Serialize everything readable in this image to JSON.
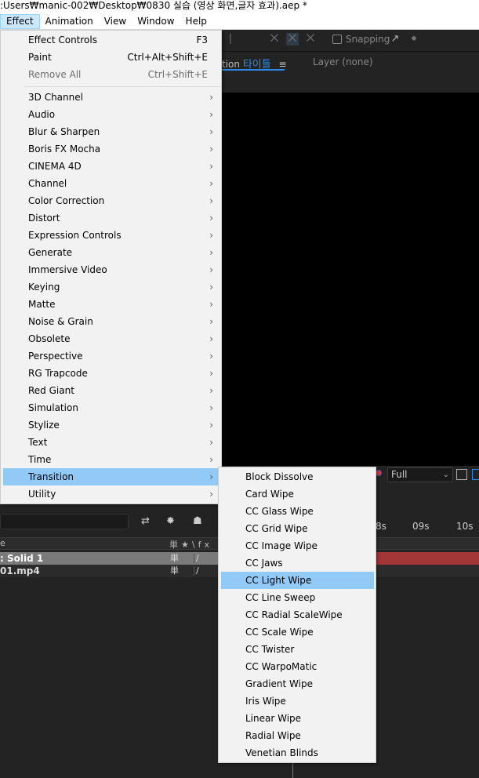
{
  "window": {
    "title": ":Users₩manic-002₩Desktop₩0830 실습 (영상 화면,글자 효과).aep *"
  },
  "menubar": {
    "items": [
      {
        "label": "Effect"
      },
      {
        "label": "Animation"
      },
      {
        "label": "View"
      },
      {
        "label": "Window"
      },
      {
        "label": "Help"
      }
    ]
  },
  "toolbar": {
    "snapping_label": "Snapping"
  },
  "composition": {
    "tab_prefix": "tion",
    "tab_name": "타이틀",
    "layer_tab": "Layer (none)",
    "quality": "Full"
  },
  "timeline": {
    "ruler_labels": [
      "8s",
      "09s",
      "10s"
    ],
    "header_left": "e",
    "header_icons": "単★\\fx",
    "layers": [
      {
        "name": "Solid 1",
        "prefix": ":"
      },
      {
        "name": "01.mp4"
      }
    ]
  },
  "effect_menu": {
    "top_items": [
      {
        "label": "Effect Controls",
        "shortcut": "F3",
        "disabled": false
      },
      {
        "label": "Paint",
        "shortcut": "Ctrl+Alt+Shift+E",
        "disabled": false
      },
      {
        "label": "Remove All",
        "shortcut": "Ctrl+Shift+E",
        "disabled": true
      }
    ],
    "categories": [
      "3D Channel",
      "Audio",
      "Blur & Sharpen",
      "Boris FX Mocha",
      "CINEMA 4D",
      "Channel",
      "Color Correction",
      "Distort",
      "Expression Controls",
      "Generate",
      "Immersive Video",
      "Keying",
      "Matte",
      "Noise & Grain",
      "Obsolete",
      "Perspective",
      "RG Trapcode",
      "Red Giant",
      "Simulation",
      "Stylize",
      "Text",
      "Time",
      "Transition",
      "Utility"
    ],
    "highlighted": "Transition"
  },
  "transition_menu": {
    "items": [
      "Block Dissolve",
      "Card Wipe",
      "CC Glass Wipe",
      "CC Grid Wipe",
      "CC Image Wipe",
      "CC Jaws",
      "CC Light Wipe",
      "CC Line Sweep",
      "CC Radial ScaleWipe",
      "CC Scale Wipe",
      "CC Twister",
      "CC WarpoMatic",
      "Gradient Wipe",
      "Iris Wipe",
      "Linear Wipe",
      "Radial Wipe",
      "Venetian Blinds"
    ],
    "highlighted": "CC Light Wipe"
  },
  "colors": {
    "accent": "#2d8ceb",
    "menu_highlight": "#91c9f7",
    "menu_bg": "#f2f2f2",
    "layer_bar": "#a33636"
  }
}
